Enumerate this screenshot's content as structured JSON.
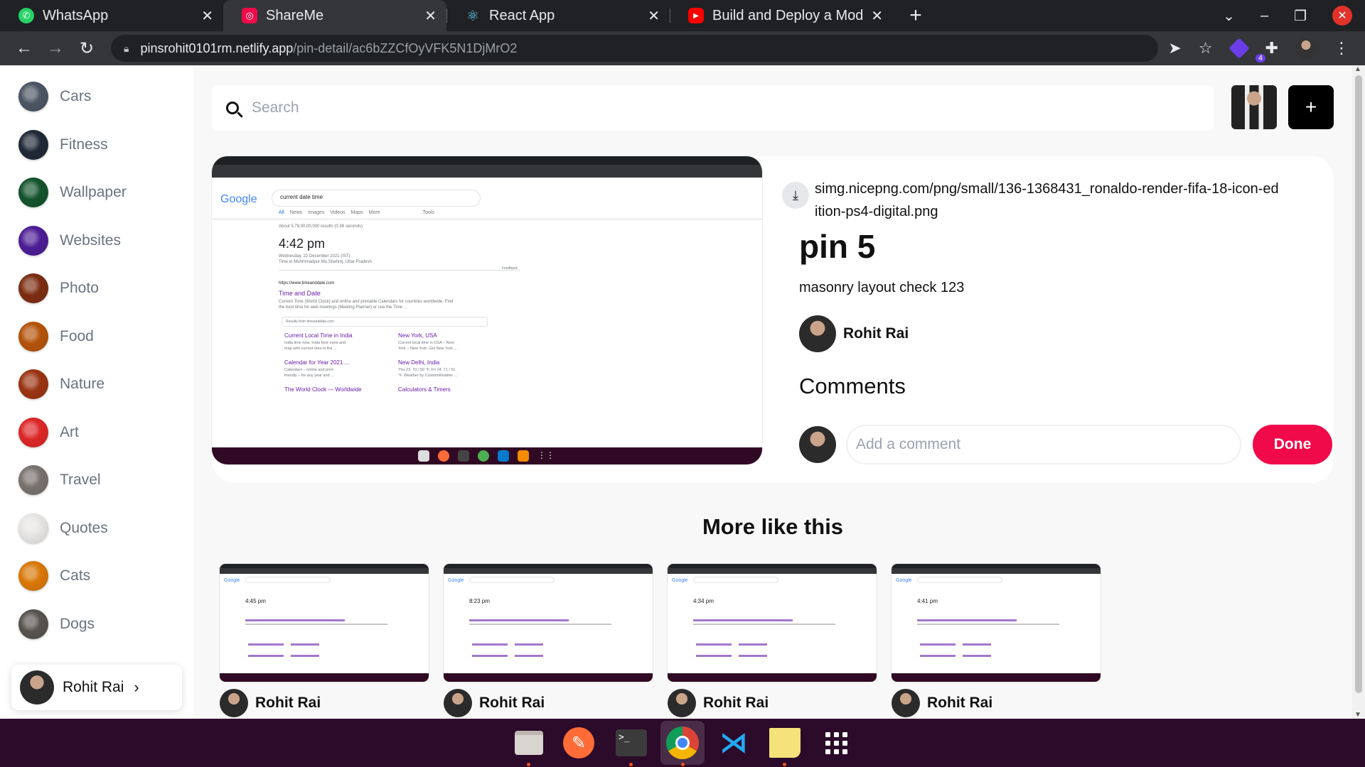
{
  "browser": {
    "tabs": [
      {
        "title": "WhatsApp",
        "icon": "whatsapp-icon",
        "color": "#25d366",
        "active": false
      },
      {
        "title": "ShareMe",
        "icon": "shareme-icon",
        "color": "#f10a4a",
        "active": true
      },
      {
        "title": "React App",
        "icon": "react-icon",
        "color": "#61dafb",
        "active": false
      },
      {
        "title": "Build and Deploy a Modern",
        "icon": "youtube-icon",
        "color": "#ff0000",
        "active": false
      }
    ],
    "url_host": "pinsrohit0101rm.netlify.app",
    "url_path": "/pin-detail/ac6bZZCfOyVFK5N1DjMrO2",
    "extension_badge": "4"
  },
  "sidebar": {
    "categories": [
      {
        "label": "Cars",
        "color": "#4b5563"
      },
      {
        "label": "Fitness",
        "color": "#1f2937"
      },
      {
        "label": "Wallpaper",
        "color": "#14532d"
      },
      {
        "label": "Websites",
        "color": "#4c1d95"
      },
      {
        "label": "Photo",
        "color": "#7c2d12"
      },
      {
        "label": "Food",
        "color": "#b45309"
      },
      {
        "label": "Nature",
        "color": "#9a3412"
      },
      {
        "label": "Art",
        "color": "#dc2626"
      },
      {
        "label": "Travel",
        "color": "#78716c"
      },
      {
        "label": "Quotes",
        "color": "#e7e5e4"
      },
      {
        "label": "Cats",
        "color": "#d97706"
      },
      {
        "label": "Dogs",
        "color": "#57534e"
      }
    ],
    "user_name": "Rohit Rai"
  },
  "search": {
    "placeholder": "Search"
  },
  "add_button_label": "+",
  "pin": {
    "destination": "simg.nicepng.com/png/small/136-1368431_ronaldo-render-fifa-18-icon-edition-ps4-digital.png",
    "title": "pin 5",
    "about": "masonry layout check 123",
    "posted_by": "Rohit Rai",
    "comments_heading": "Comments",
    "comment_placeholder": "Add a comment",
    "done_label": "Done",
    "screenshot": {
      "google_logo": "Google",
      "query": "current date time",
      "tabs": [
        "All",
        "News",
        "Images",
        "Videos",
        "Maps",
        "More",
        "Tools"
      ],
      "results_count": "About 5,78,00,00,000 results (0.38 seconds)",
      "time": "4:42 pm",
      "date_line": "Wednesday, 22 December 2021 (IST)",
      "location_line": "Time in Muhmmadpur Mu.Shahroj, Uttar Pradesh",
      "feedback": "Feedback",
      "result_url": "https://www.timeanddate.com",
      "result_title": "Time and Date",
      "result_snippet_1": "Current Time (World Clock) and online and printable Calendars for countries worldwide. Find",
      "result_snippet_2": "the best time for web meetings (Meeting Planner) or use the Time ...",
      "site_search_placeholder": "Results from timeanddate.com",
      "links": [
        {
          "title": "Current Local Time in India",
          "desc1": "India time now. India time zone and",
          "desc2": "map with current time in the ..."
        },
        {
          "title": "New York, USA",
          "desc1": "Current local time in USA – New",
          "desc2": "York – New York. Get New York ..."
        },
        {
          "title": "Calendar for Year 2021 ...",
          "desc1": "Calendars – online and print",
          "desc2": "friendly – for any year and ..."
        },
        {
          "title": "New Delhi, India",
          "desc1": "Thu 23. 70 / 50 °F. Fri 24. 71 / 51",
          "desc2": "°F. Weather by CustomWeather ..."
        },
        {
          "title": "The World Clock — Worldwide",
          "desc1": "",
          "desc2": ""
        },
        {
          "title": "Calculators & Timers",
          "desc1": "",
          "desc2": ""
        }
      ]
    }
  },
  "more_like_this": {
    "heading": "More like this",
    "items": [
      {
        "time": "4:45 pm",
        "author": "Rohit Rai"
      },
      {
        "time": "8:23 pm",
        "author": "Rohit Rai"
      },
      {
        "time": "4:34 pm",
        "author": "Rohit Rai"
      },
      {
        "time": "4:41 pm",
        "author": "Rohit Rai"
      }
    ]
  },
  "dock": [
    "files-icon",
    "postman-icon",
    "terminal-icon",
    "chrome-icon",
    "vscode-icon",
    "sticky-notes-icon",
    "app-grid-icon"
  ]
}
